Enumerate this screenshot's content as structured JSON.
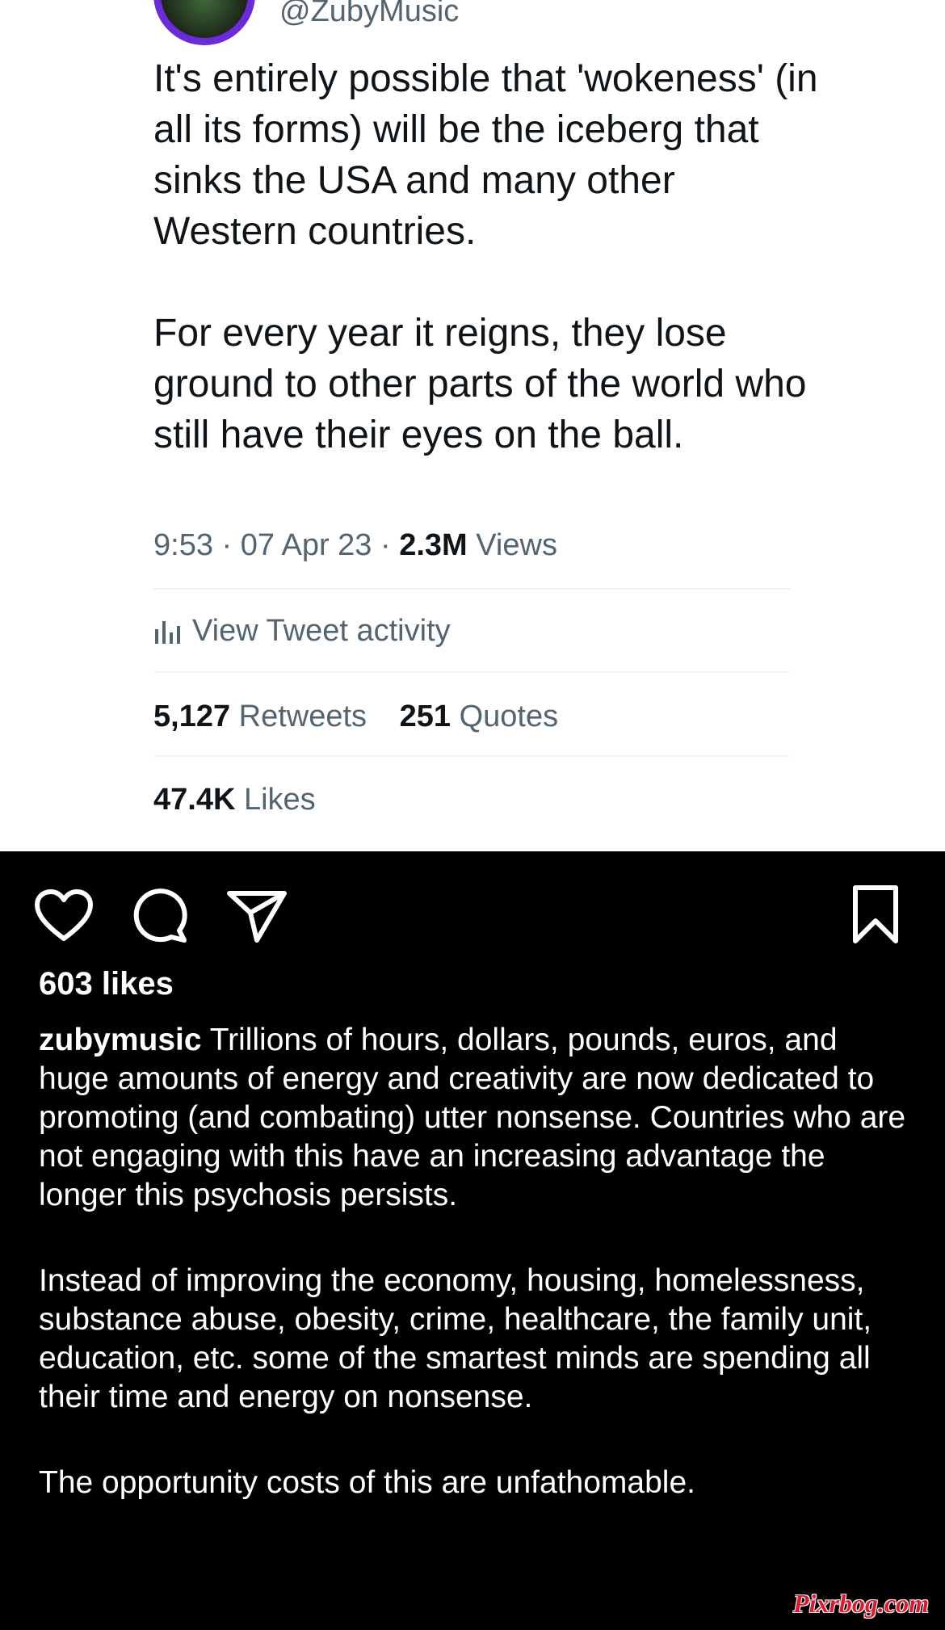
{
  "tweet": {
    "handle": "@ZubyMusic",
    "paragraphs": [
      "It's entirely possible that 'wokeness' (in all its forms) will be the iceberg that sinks the USA and many other Western countries.",
      "For every year it reigns, they lose ground to other parts of the world who still have their eyes on the ball."
    ],
    "time": "9:53",
    "date": "07 Apr 23",
    "views_count": "2.3M",
    "views_label": "Views",
    "activity_label": "View Tweet activity",
    "retweets_count": "5,127",
    "retweets_label": "Retweets",
    "quotes_count": "251",
    "quotes_label": "Quotes",
    "likes_count": "47.4K",
    "likes_label": "Likes"
  },
  "instagram": {
    "likes": "603 likes",
    "caption_user": "zubymusic",
    "caption_first": "Trillions of hours, dollars, pounds, euros, and huge amounts of energy and creativity are now dedicated to promoting (and combating) utter nonsense. Countries who are not engaging with this have an increasing advantage the longer this psychosis persists.",
    "caption_paragraphs": [
      "Instead of improving the economy, housing, homelessness, substance abuse, obesity, crime, healthcare, the family unit, education, etc. some of the smartest minds are spending all their time and energy on nonsense.",
      "The opportunity costs of this are unfathomable."
    ],
    "icons": [
      "heart-icon",
      "comment-icon",
      "share-icon",
      "bookmark-icon"
    ]
  },
  "watermark": "Pixrbog.com",
  "colors": {
    "tweet_text": "#0f1419",
    "tweet_secondary": "#536471",
    "avatar_ring": "#6a2bd9",
    "watermark": "#e0182d"
  }
}
